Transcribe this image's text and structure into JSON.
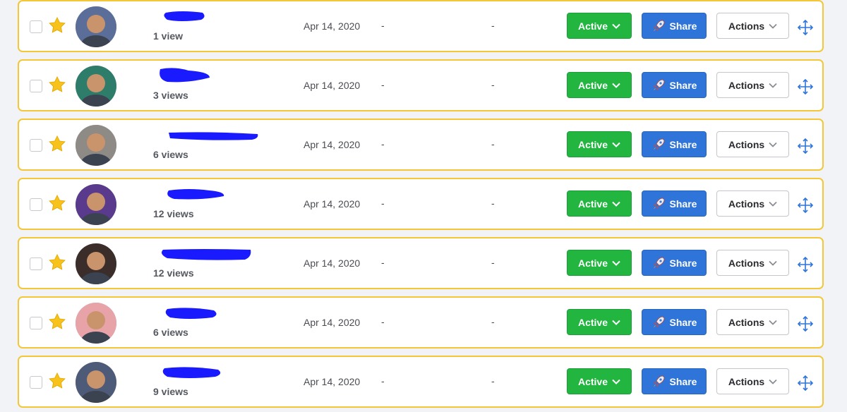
{
  "colors": {
    "row_border": "#f3c738",
    "status_green": "#22b640",
    "share_blue": "#2f74d8",
    "redaction_blue": "#1a1aff",
    "move_icon_blue": "#2f74d8",
    "star_yellow": "#f6c21b"
  },
  "icons": {
    "checkbox": "checkbox-icon",
    "star": "star-icon",
    "share": "rocket-icon",
    "dropdown": "chevron-down-icon",
    "move": "move-arrows-icon"
  },
  "rows": [
    {
      "views": "1 view",
      "date": "Apr 14, 2020",
      "col1": "-",
      "col2": "-",
      "status_label": "Active",
      "share_label": "Share",
      "actions_label": "Actions",
      "avatar_color": "#5b6e9a"
    },
    {
      "views": "3 views",
      "date": "Apr 14, 2020",
      "col1": "-",
      "col2": "-",
      "status_label": "Active",
      "share_label": "Share",
      "actions_label": "Actions",
      "avatar_color": "#2e7d6b"
    },
    {
      "views": "6 views",
      "date": "Apr 14, 2020",
      "col1": "-",
      "col2": "-",
      "status_label": "Active",
      "share_label": "Share",
      "actions_label": "Actions",
      "avatar_color": "#8e8a86"
    },
    {
      "views": "12 views",
      "date": "Apr 14, 2020",
      "col1": "-",
      "col2": "-",
      "status_label": "Active",
      "share_label": "Share",
      "actions_label": "Actions",
      "avatar_color": "#5a3a8c"
    },
    {
      "views": "12 views",
      "date": "Apr 14, 2020",
      "col1": "-",
      "col2": "-",
      "status_label": "Active",
      "share_label": "Share",
      "actions_label": "Actions",
      "avatar_color": "#3a2d2a"
    },
    {
      "views": "6 views",
      "date": "Apr 14, 2020",
      "col1": "-",
      "col2": "-",
      "status_label": "Active",
      "share_label": "Share",
      "actions_label": "Actions",
      "avatar_color": "#e7a3a8"
    },
    {
      "views": "9 views",
      "date": "Apr 14, 2020",
      "col1": "-",
      "col2": "-",
      "status_label": "Active",
      "share_label": "Share",
      "actions_label": "Actions",
      "avatar_color": "#4d5b78"
    }
  ]
}
